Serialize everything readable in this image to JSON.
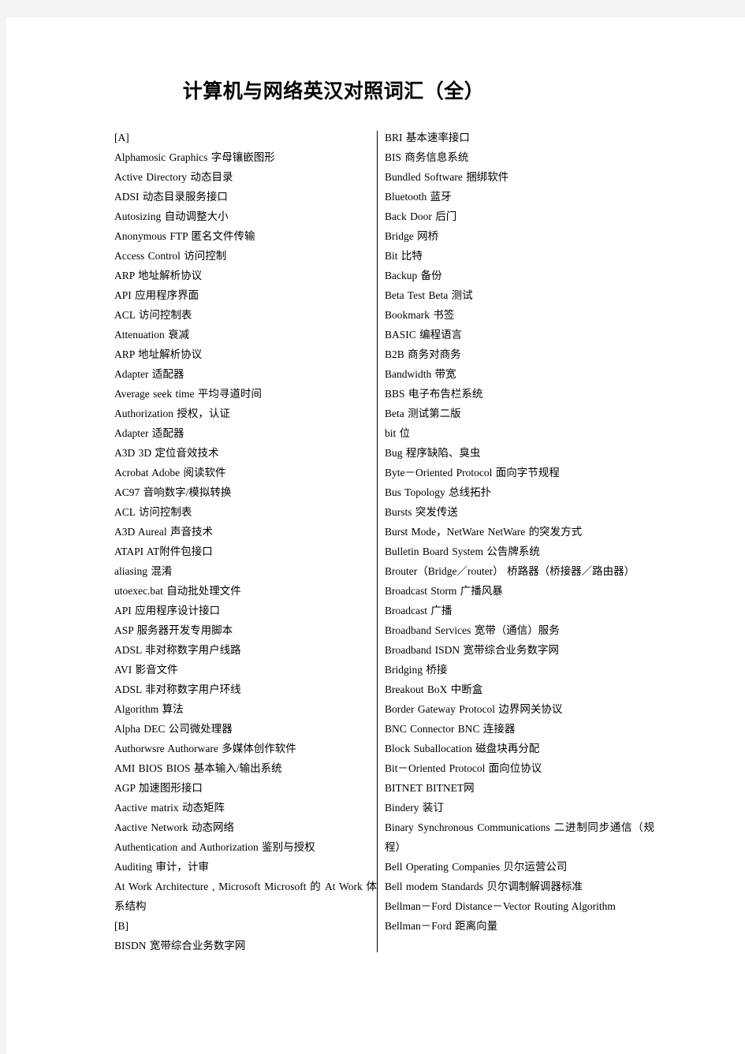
{
  "document": {
    "title": "计算机与网络英汉对照词汇（全）",
    "background_color": "#f4f4f4",
    "page_color": "#ffffff",
    "text_color": "#000000",
    "divider_color": "#000000"
  },
  "columns": {
    "left": {
      "entries": [
        "[A]",
        "Alphamosic Graphics   字母镶嵌图形",
        "Active Directory   动态目录",
        "ADSI  动态目录服务接口",
        "Autosizing   自动调整大小",
        "Anonymous FTP   匿名文件传输",
        "Access Control   访问控制",
        "ARP  地址解析协议",
        "API  应用程序界面",
        "ACL  访问控制表",
        "Attenuation   衰减",
        "ARP  地址解析协议",
        "Adapter  适配器",
        "Average seek time   平均寻道时间",
        "Authorization  授权，认证",
        "Adapter  适配器",
        "A3D 3D 定位音效技术",
        "Acrobat Adobe 阅读软件",
        "AC97  音响数字/模拟转换",
        "ACL  访问控制表",
        "A3D Aureal 声音技术",
        "ATAPI AT附件包接口",
        "aliasing   混淆",
        "utoexec.bat   自动批处理文件",
        "API  应用程序设计接口",
        "ASP  服务器开发专用脚本",
        "ADSL  非对称数字用户线路",
        "AVI  影音文件",
        "ADSL  非对称数字用户环线",
        "Algorithm   算法",
        "Alpha DEC 公司微处理器",
        "Authorwsre Authorware   多媒体创作软件",
        "AMI BIOS BIOS 基本输入/输出系统",
        "AGP  加速图形接口",
        "Aactive matrix   动态矩阵",
        "Aactive Network   动态网络",
        "Authentication and Authorization   鉴别与授权",
        "Auditing  审计，计审",
        "At Work Architecture , Microsoft Microsoft 的 At Work 体系结构",
        "[B]",
        "BISDN  宽带综合业务数字网"
      ]
    },
    "right": {
      "entries": [
        "BRI  基本速率接口",
        "BIS  商务信息系统",
        "Bundled Software   捆绑软件",
        "Bluetooth   蓝牙",
        "Back Door  后门",
        "Bridge   网桥",
        "Bit  比特",
        "Backup  备份",
        "Beta Test Beta 测试",
        "Bookmark  书签",
        "BASIC  编程语言",
        "B2B  商务对商务",
        "Bandwidth  带宽",
        "BBS  电子布告栏系统",
        "Beta  测试第二版",
        "bit  位",
        "Bug  程序缺陷、臭虫",
        "Byte－Oriented Protocol   面向字节规程",
        "Bus Topology   总线拓扑",
        "Bursts  突发传送",
        "Burst Mode，NetWare NetWare 的突发方式",
        "Bulletin Board System   公告牌系统",
        "Brouter（Bridge／router）  桥路器（桥接器／路由器）",
        "Broadcast Storm   广播风暴",
        "Broadcast  广播",
        "Broadband Services   宽带（通信）服务",
        "Broadband ISDN  宽带综合业务数字网",
        "Bridging   桥接",
        "Breakout BoX   中断盒",
        "Border Gateway Protocol   边界网关协议",
        "BNC Connector BNC 连接器",
        "Block Suballocation   磁盘块再分配",
        "Bit－Oriented Protocol   面向位协议",
        "BITNET BITNET网",
        "Bindery  装订",
        "Binary Synchronous Communications   二进制同步通信（规程）",
        "Bell Operating Companies   贝尔运营公司",
        "Bell modem Standards   贝尔调制解调器标准",
        "Bellman－Ford Distance－Vector Routing Algorithm",
        "Bellman－Ford 距离向量"
      ]
    }
  }
}
